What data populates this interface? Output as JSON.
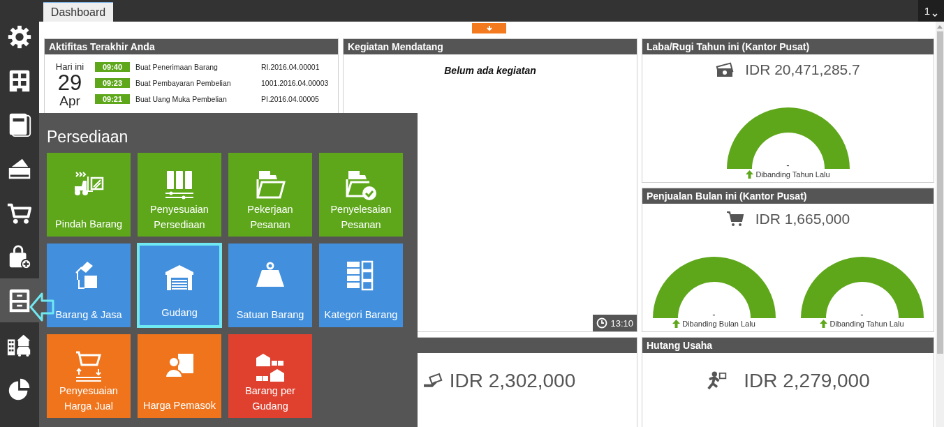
{
  "sidebar": {
    "items": [
      {
        "selected": false
      },
      {
        "selected": false
      },
      {
        "selected": false
      },
      {
        "selected": false
      },
      {
        "selected": false
      },
      {
        "selected": false
      },
      {
        "selected": true
      },
      {
        "selected": false
      },
      {
        "selected": false
      }
    ]
  },
  "tabs": [
    {
      "label": "Dashboard",
      "selected": true
    }
  ],
  "page_selector": "1",
  "recent_activity": {
    "title": "Aktifitas Terakhir Anda",
    "date": {
      "caption": "Hari ini",
      "day": "29",
      "month": "Apr"
    },
    "rows": [
      {
        "time": "09:40",
        "action": "Buat Penerimaan Barang",
        "reference": "RI.2016.04.00001"
      },
      {
        "time": "09:23",
        "action": "Buat Pembayaran Pembelian",
        "reference": "1001.2016.04.00003"
      },
      {
        "time": "09:21",
        "action": "Buat Uang Muka Pembelian",
        "reference": "PI.2016.04.00005"
      }
    ]
  },
  "upcoming": {
    "title": "Kegiatan Mendatang",
    "empty_message": "Belum ada kegiatan",
    "time": "13:10"
  },
  "profit": {
    "title": "Laba/Rugi Tahun ini (Kantor Pusat)",
    "amount": "IDR 20,471,285.7",
    "gauges": [
      {
        "value": "-",
        "caption": "Dibanding Tahun Lalu"
      }
    ]
  },
  "sales": {
    "title": "Penjualan Bulan ini (Kantor Pusat)",
    "amount": "IDR 1,665,000",
    "gauges": [
      {
        "value": "-",
        "caption": "Dibanding Bulan Lalu"
      },
      {
        "value": "-",
        "caption": "Dibanding Tahun Lalu"
      }
    ]
  },
  "amount_panel": {
    "amount": "IDR 2,302,000"
  },
  "payables": {
    "title": "Hutang Usaha",
    "amount": "IDR 2,279,000"
  },
  "flyout": {
    "title": "Persediaan",
    "tiles": [
      {
        "label": "Pindah Barang",
        "color": "#5ea71b",
        "selected": false
      },
      {
        "label": "Penyesuaian Persediaan",
        "color": "#5ea71b",
        "selected": false
      },
      {
        "label": "Pekerjaan Pesanan",
        "color": "#5ea71b",
        "selected": false
      },
      {
        "label": "Penyelesaian Pesanan",
        "color": "#5ea71b",
        "selected": false
      },
      {
        "label": "Barang & Jasa",
        "color": "#418fdd",
        "selected": false
      },
      {
        "label": "Gudang",
        "color": "#418fdd",
        "selected": true
      },
      {
        "label": "Satuan Barang",
        "color": "#418fdd",
        "selected": false
      },
      {
        "label": "Kategori Barang",
        "color": "#418fdd",
        "selected": false
      },
      {
        "label": "Penyesuaian Harga Jual",
        "color": "#ef741c",
        "selected": false
      },
      {
        "label": "Harga Pemasok",
        "color": "#ef741c",
        "selected": false
      },
      {
        "label": "Barang per Gudang",
        "color": "#e0412f",
        "selected": false
      }
    ]
  }
}
